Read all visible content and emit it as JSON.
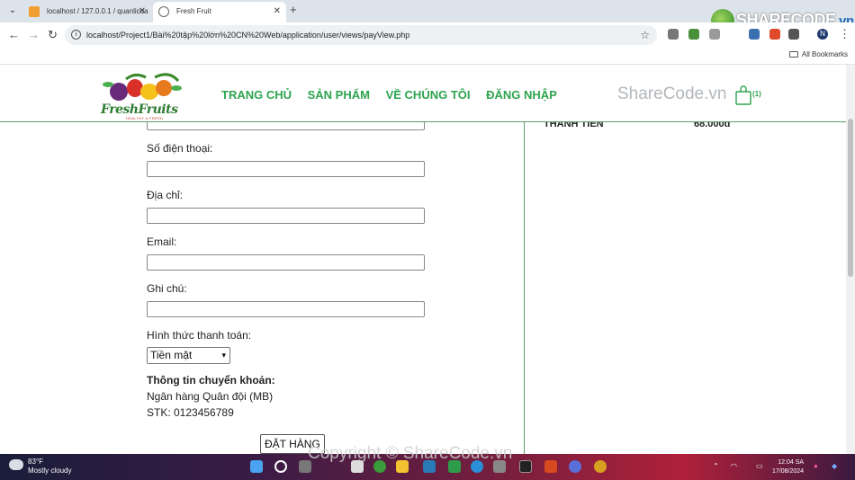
{
  "browser": {
    "tabs": [
      {
        "title": "localhost / 127.0.0.1 / quanlicua",
        "active": false
      },
      {
        "title": "Fresh Fruit",
        "active": true
      }
    ],
    "url": "localhost/Project1/Bài%20tập%20lớn%20CN%20Web/application/user/views/payView.php",
    "bookmarks_label": "All Bookmarks",
    "profile_initial": "N"
  },
  "watermark": {
    "logo_text": "SHARECODE",
    "logo_suffix": ".vn",
    "header_text": "ShareCode.vn",
    "footer_text": "Copyright © ShareCode.vn"
  },
  "site": {
    "brand": "FreshFruits",
    "tagline": "HEALTHY & FRESH",
    "menu": [
      "TRANG CHỦ",
      "SẢN PHẨM",
      "VỀ CHÚNG TÔI",
      "ĐĂNG NHẬP"
    ],
    "cart_count": "(1)"
  },
  "form": {
    "phone_label": "Số điện thoại:",
    "address_label": "Địa chỉ:",
    "email_label": "Email:",
    "note_label": "Ghi chú:",
    "payment_label": "Hình thức thanh toán:",
    "payment_selected": "Tiền mặt",
    "transfer_title": "Thông tin chuyển khoản:",
    "bank": "Ngân hàng Quân đội (MB)",
    "account": "STK: 0123456789",
    "submit_label": "ĐẶT HÀNG"
  },
  "summary": {
    "total_label": "THÀNH TIỀN",
    "total_value": "68.000đ"
  },
  "taskbar": {
    "temperature": "83°F",
    "weather": "Mostly cloudy",
    "time": "12:04 SA",
    "date": "17/08/2024"
  }
}
